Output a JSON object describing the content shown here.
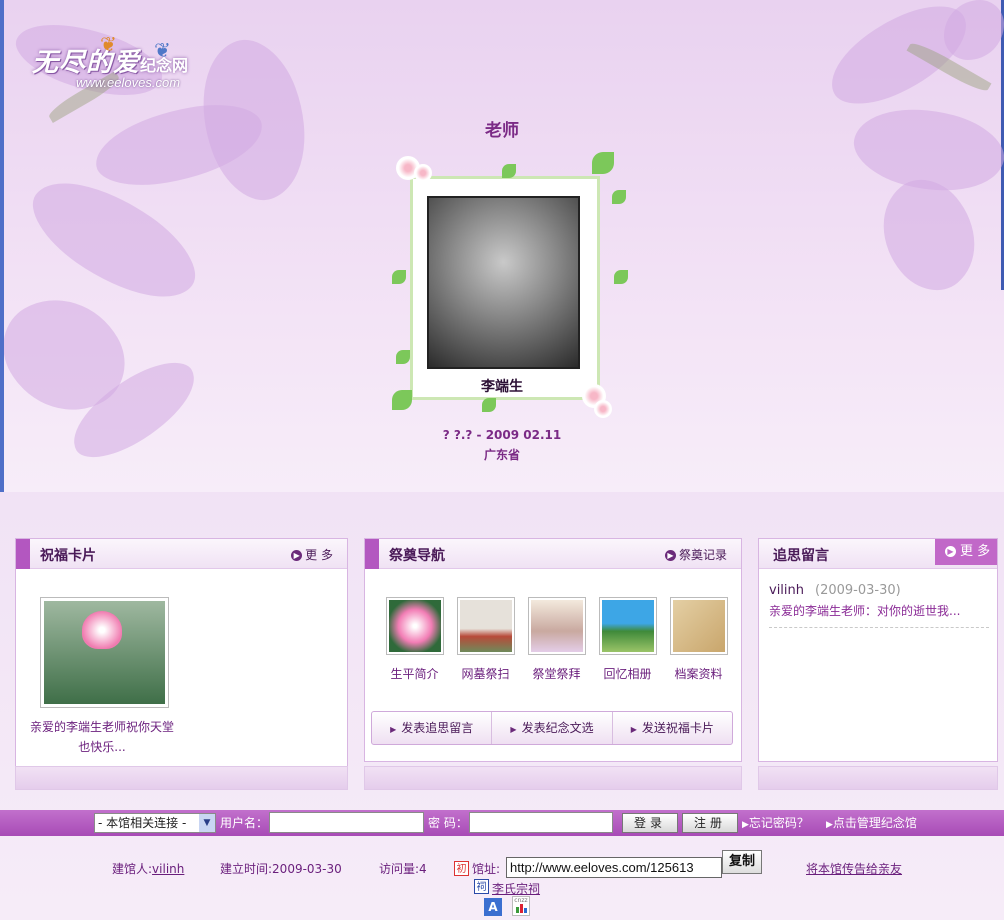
{
  "site": {
    "logo_main": "无尽的爱",
    "logo_sub": "纪念网",
    "logo_url": "www.eeloves.com"
  },
  "memorial": {
    "honorific": "老师",
    "name": "李端生",
    "dates": "? ?.? - 2009 02.11",
    "province": "广东省"
  },
  "panels": {
    "blessing": {
      "title": "祝福卡片",
      "more": "更 多",
      "card_text": "亲爱的李端生老师祝你天堂也快乐..."
    },
    "nav": {
      "title": "祭奠导航",
      "more": "祭奠记录",
      "items": [
        {
          "label": "生平简介",
          "icon": "lotus-flower-image"
        },
        {
          "label": "网墓祭扫",
          "icon": "tomb-image"
        },
        {
          "label": "祭堂祭拜",
          "icon": "memorial-hall-image"
        },
        {
          "label": "回忆相册",
          "icon": "tree-photo-image"
        },
        {
          "label": "档案资料",
          "icon": "archive-folder-image"
        }
      ],
      "actions": [
        "发表追思留言",
        "发表纪念文选",
        "发送祝福卡片"
      ]
    },
    "messages": {
      "title": "追思留言",
      "more": "更 多",
      "user": "vilinh",
      "date": "(2009-03-30)",
      "text": "亲爱的李端生老师：对你的逝世我..."
    }
  },
  "login": {
    "links_select": "- 本馆相关连接 -",
    "username_label": "用户名：",
    "password_label": "密 码：",
    "login_button": "登录",
    "register_button": "注册",
    "forgot": "忘记密码？",
    "manage": "点击管理纪念馆"
  },
  "footer": {
    "founder_label": "建馆人:",
    "founder": "vilinh",
    "created": "建立时间:2009-03-30",
    "visits": "访问量:4",
    "address_label": "馆址:",
    "address": "http://www.eeloves.com/125613",
    "copy_button": "复制",
    "share": "将本馆传告给亲友",
    "clan_link": "李氏宗祠",
    "badge_chu": "初",
    "badge_ci": "祠",
    "badge_a": "A",
    "badge_cnzz": "cnzz"
  },
  "colors": {
    "accent": "#b357c0",
    "text": "#6a1e7c",
    "login_bar": "#b85bc4"
  }
}
